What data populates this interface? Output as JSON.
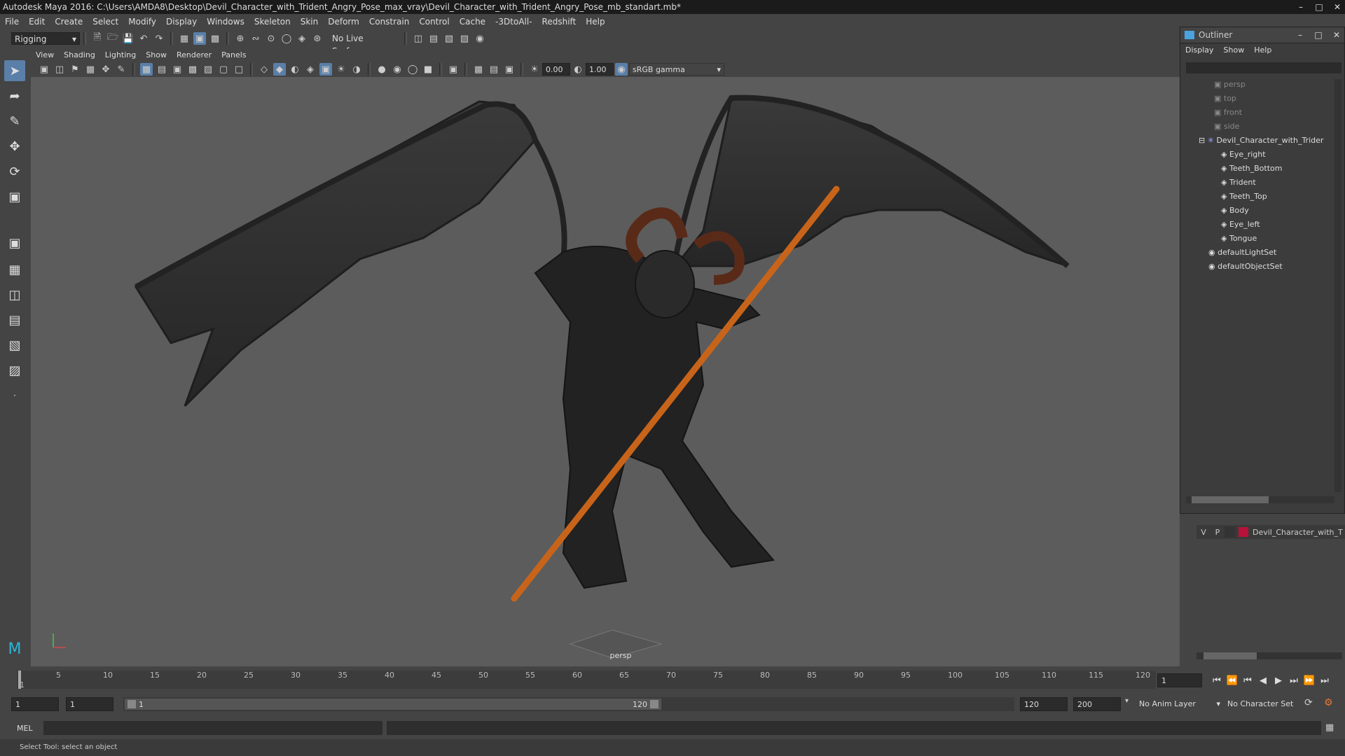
{
  "window": {
    "title": "Autodesk Maya 2016: C:\\Users\\AMDA8\\Desktop\\Devil_Character_with_Trident_Angry_Pose_max_vray\\Devil_Character_with_Trident_Angry_Pose_mb_standart.mb*",
    "minimize": "–",
    "maximize": "□",
    "close": "✕"
  },
  "menubar": [
    "File",
    "Edit",
    "Create",
    "Select",
    "Modify",
    "Display",
    "Windows",
    "Skeleton",
    "Skin",
    "Deform",
    "Constrain",
    "Control",
    "Cache",
    "-3DtoAll-",
    "Redshift",
    "Help"
  ],
  "statusline": {
    "menuset": "Rigging",
    "live_surface": "No Live Surface"
  },
  "viewport": {
    "menus": [
      "View",
      "Shading",
      "Lighting",
      "Show",
      "Renderer",
      "Panels"
    ],
    "exposure": "0.00",
    "gamma": "1.00",
    "colorspace": "sRGB gamma",
    "camera_label": "persp"
  },
  "outliner": {
    "title": "Outliner",
    "menus": [
      "Display",
      "Show",
      "Help"
    ],
    "items": [
      {
        "label": "persp",
        "dim": true,
        "kind": "camera"
      },
      {
        "label": "top",
        "dim": true,
        "kind": "camera"
      },
      {
        "label": "front",
        "dim": true,
        "kind": "camera"
      },
      {
        "label": "side",
        "dim": true,
        "kind": "camera"
      },
      {
        "label": "Devil_Character_with_Trider",
        "dim": false,
        "kind": "group"
      },
      {
        "label": "Eye_right",
        "dim": false,
        "kind": "mesh"
      },
      {
        "label": "Teeth_Bottom",
        "dim": false,
        "kind": "mesh"
      },
      {
        "label": "Trident",
        "dim": false,
        "kind": "mesh"
      },
      {
        "label": "Teeth_Top",
        "dim": false,
        "kind": "mesh"
      },
      {
        "label": "Body",
        "dim": false,
        "kind": "mesh"
      },
      {
        "label": "Eye_left",
        "dim": false,
        "kind": "mesh"
      },
      {
        "label": "Tongue",
        "dim": false,
        "kind": "mesh"
      },
      {
        "label": "defaultLightSet",
        "dim": false,
        "kind": "set"
      },
      {
        "label": "defaultObjectSet",
        "dim": false,
        "kind": "set"
      }
    ]
  },
  "layer": {
    "v": "V",
    "p": "P",
    "name": "Devil_Character_with_T",
    "color": "#b8123a"
  },
  "timeline": {
    "ticks": [
      "1",
      "5",
      "10",
      "15",
      "20",
      "25",
      "30",
      "35",
      "40",
      "45",
      "50",
      "55",
      "60",
      "65",
      "70",
      "75",
      "80",
      "85",
      "90",
      "95",
      "100",
      "105",
      "110",
      "115",
      "120"
    ],
    "current_frame": "1",
    "playback_start": "1",
    "range_start": "1",
    "range_inner_start": "1",
    "range_inner_end": "120",
    "range_end": "120",
    "anim_end": "200",
    "anim_layer": "No Anim Layer",
    "character_set": "No Character Set"
  },
  "cmdline": {
    "label": "MEL"
  },
  "helpline": {
    "text": "Select Tool: select an object"
  },
  "colors": {
    "accent": "#5a7fa8",
    "viewport_bg": "#5c5c5c",
    "trident": "#e0791c"
  }
}
